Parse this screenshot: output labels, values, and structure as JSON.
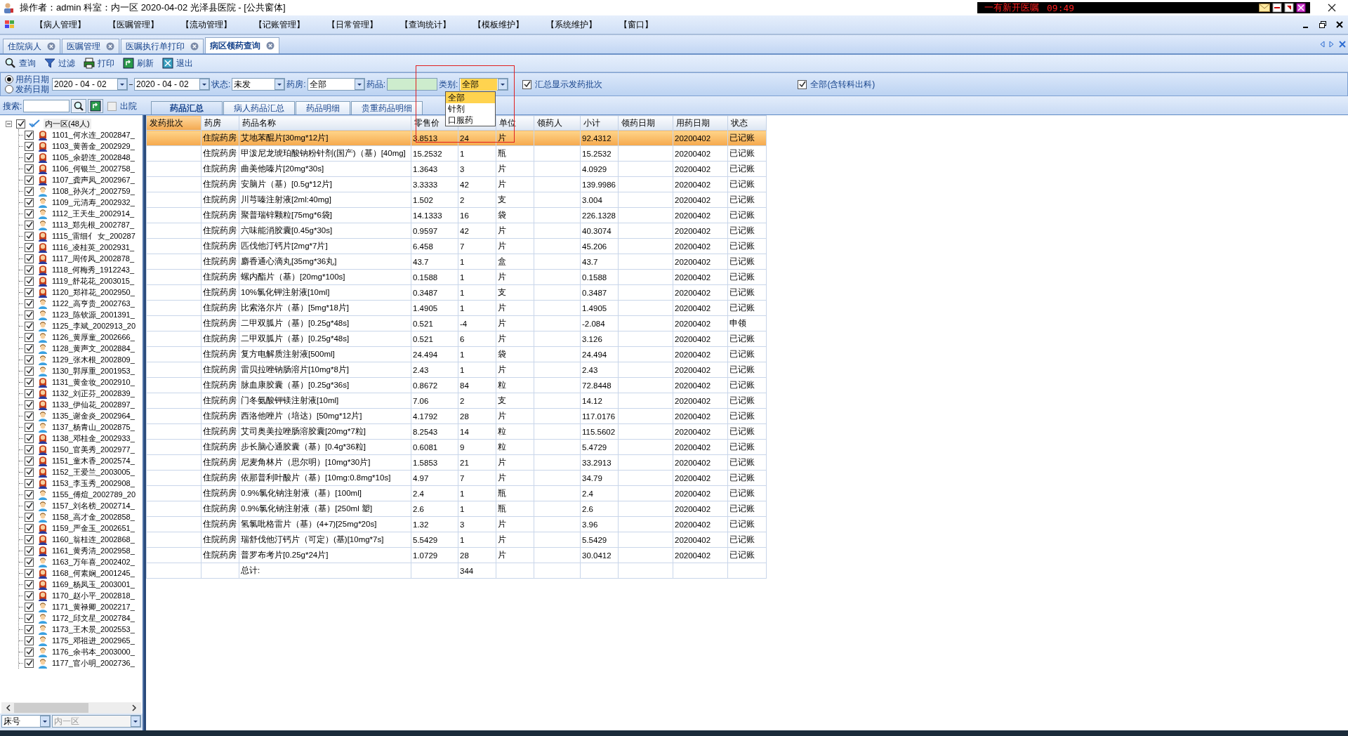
{
  "title_bar": {
    "text": "操作者：admin  科室：内一区  2020-04-02  光泽县医院 - [公共窗体]",
    "notice": {
      "text": "一有新开医嘱",
      "time": "09:49"
    }
  },
  "menu": [
    "【病人管理】",
    "【医嘱管理】",
    "【流动管理】",
    "【记账管理】",
    "【日常管理】",
    "【查询统计】",
    "【模板维护】",
    "【系统维护】",
    "【窗口】"
  ],
  "tabs": [
    {
      "label": "住院病人",
      "selected": false
    },
    {
      "label": "医嘱管理",
      "selected": false
    },
    {
      "label": "医嘱执行单打印",
      "selected": false
    },
    {
      "label": "病区领药查询",
      "selected": true
    }
  ],
  "toolbar": [
    {
      "label": "查询",
      "kind": "search"
    },
    {
      "label": "过滤",
      "kind": "filter"
    },
    {
      "label": "打印",
      "kind": "print"
    },
    {
      "label": "刷新",
      "kind": "refresh"
    },
    {
      "label": "退出",
      "kind": "exit"
    }
  ],
  "filters": {
    "date_modes": [
      {
        "label": "用药日期",
        "selected": true
      },
      {
        "label": "发药日期",
        "selected": false
      }
    ],
    "date_from": "2020 - 04 - 02",
    "date_to": "2020 - 04 - 02",
    "status": {
      "label": "状态:",
      "value": "未发"
    },
    "pharmacy": {
      "label": "药房:",
      "value": "全部"
    },
    "drug": {
      "label": "药品:"
    },
    "category": {
      "label": "类别:",
      "value": "全部",
      "options": [
        {
          "label": "全部",
          "selected": true
        },
        {
          "label": "针剂",
          "selected": false
        },
        {
          "label": "口服药",
          "selected": false
        }
      ]
    },
    "show_batch": {
      "label": "汇总显示发药批次",
      "checked": true
    },
    "all_depts": {
      "label": "全部(含转科出科)",
      "checked": true
    }
  },
  "search": {
    "label": "搜索:",
    "discharged": {
      "label": "出院",
      "checked": false
    }
  },
  "subtabs": [
    {
      "label": "药品汇总",
      "selected": true
    },
    {
      "label": "病人药品汇总",
      "selected": false
    },
    {
      "label": "药品明细",
      "selected": false
    },
    {
      "label": "贵重药品明细",
      "selected": false
    }
  ],
  "tree": {
    "label": "内一区(48人)",
    "checked": true,
    "expanded": true,
    "children": [
      {
        "label": "1101_何水连_2002847_",
        "kind": "female",
        "checked": true
      },
      {
        "label": "1103_黄善金_2002929_",
        "kind": "female",
        "checked": true
      },
      {
        "label": "1105_余碧连_2002848_",
        "kind": "female",
        "checked": true
      },
      {
        "label": "1106_何银兰_2002758_",
        "kind": "female",
        "checked": true
      },
      {
        "label": "1107_龚声凤_2002967_",
        "kind": "female",
        "checked": true
      },
      {
        "label": "1108_孙兴才_2002759_",
        "kind": "male",
        "checked": true
      },
      {
        "label": "1109_元清寿_2002932_",
        "kind": "male",
        "checked": true
      },
      {
        "label": "1112_王天生_2002914_",
        "kind": "male",
        "checked": true
      },
      {
        "label": "1113_郑先根_2002787_",
        "kind": "male",
        "checked": true
      },
      {
        "label": "1115_雷细亻 女_200287",
        "kind": "female",
        "checked": true
      },
      {
        "label": "1116_凌桂英_2002931_",
        "kind": "female",
        "checked": true
      },
      {
        "label": "1117_周传凤_2002878_",
        "kind": "female",
        "checked": true
      },
      {
        "label": "1118_何梅秀_1912243_",
        "kind": "female",
        "checked": true
      },
      {
        "label": "1119_舒花花_2003015_",
        "kind": "female",
        "checked": true
      },
      {
        "label": "1120_郑祥花_2002950_",
        "kind": "female",
        "checked": true
      },
      {
        "label": "1122_高亨贵_2002763_",
        "kind": "male",
        "checked": true
      },
      {
        "label": "1123_陈钦源_2001391_",
        "kind": "male",
        "checked": true
      },
      {
        "label": "1125_李斌_2002913_20",
        "kind": "male",
        "checked": true
      },
      {
        "label": "1126_黄厚童_2002666_",
        "kind": "male",
        "checked": true
      },
      {
        "label": "1128_黄声文_2002884_",
        "kind": "male",
        "checked": true
      },
      {
        "label": "1129_张木根_2002809_",
        "kind": "male",
        "checked": true
      },
      {
        "label": "1130_郭厚重_2001953_",
        "kind": "male",
        "checked": true
      },
      {
        "label": "1131_黄金妆_2002910_",
        "kind": "female",
        "checked": true
      },
      {
        "label": "1132_刘正芬_2002839_",
        "kind": "female",
        "checked": true
      },
      {
        "label": "1133_伊仙花_2002897_",
        "kind": "female",
        "checked": true
      },
      {
        "label": "1135_谢金炎_2002964_",
        "kind": "male",
        "checked": true
      },
      {
        "label": "1137_杨青山_2002875_",
        "kind": "male",
        "checked": true
      },
      {
        "label": "1138_邓桂金_2002933_",
        "kind": "female",
        "checked": true
      },
      {
        "label": "1150_官美秀_2002977_",
        "kind": "female",
        "checked": true
      },
      {
        "label": "1151_童木香_2002574_",
        "kind": "female",
        "checked": true
      },
      {
        "label": "1152_王爱兰_2003005_",
        "kind": "female",
        "checked": true
      },
      {
        "label": "1153_李玉秀_2002908_",
        "kind": "female",
        "checked": true
      },
      {
        "label": "1155_傅煊_2002789_20",
        "kind": "male",
        "checked": true
      },
      {
        "label": "1157_刘名榜_2002714_",
        "kind": "male",
        "checked": true
      },
      {
        "label": "1158_高才金_2002858_",
        "kind": "male",
        "checked": true
      },
      {
        "label": "1159_严金玉_2002651_",
        "kind": "female",
        "checked": true
      },
      {
        "label": "1160_翁桂连_2002868_",
        "kind": "female",
        "checked": true
      },
      {
        "label": "1161_黄秀清_2002958_",
        "kind": "female",
        "checked": true
      },
      {
        "label": "1163_万年喜_2002402_",
        "kind": "male",
        "checked": true
      },
      {
        "label": "1168_何素娴_2001245_",
        "kind": "female",
        "checked": true
      },
      {
        "label": "1169_杨凤玉_2003001_",
        "kind": "female",
        "checked": true
      },
      {
        "label": "1170_赵小平_2002818_",
        "kind": "female",
        "checked": true
      },
      {
        "label": "1171_黄禄卿_2002217_",
        "kind": "male",
        "checked": true
      },
      {
        "label": "1172_邱文星_2002784_",
        "kind": "male",
        "checked": true
      },
      {
        "label": "1173_王木景_2002553_",
        "kind": "male",
        "checked": true
      },
      {
        "label": "1175_邓祖进_2002965_",
        "kind": "male",
        "checked": true
      },
      {
        "label": "1176_余书本_2003000_",
        "kind": "male",
        "checked": true
      },
      {
        "label": "1177_官小明_2002736_",
        "kind": "male",
        "checked": true
      }
    ]
  },
  "tree_footer": {
    "sort": "床号",
    "ward": {
      "value": "内一区",
      "disabled": true
    }
  },
  "table": {
    "columns": [
      {
        "label": "发药批次"
      },
      {
        "label": "药房"
      },
      {
        "label": "药品名称"
      },
      {
        "label": "零售价"
      },
      {
        "covered": true
      },
      {
        "label": "单位"
      },
      {
        "label": "领药人"
      },
      {
        "label": "小计"
      },
      {
        "label": "领药日期"
      },
      {
        "label": "用药日期"
      },
      {
        "label": "状态"
      }
    ],
    "rows": [
      {
        "pharmacy": "住院药房",
        "name": "艾地苯醌片[30mg*12片]",
        "price": "3.8513",
        "qty": "24",
        "unit": "片",
        "subtotal": "92.4312",
        "date": "20200402",
        "status": "已记账",
        "selected": true
      },
      {
        "pharmacy": "住院药房",
        "name": "甲泼尼龙琥珀酸钠粉针剂(国产)（基）[40mg]",
        "price": "15.2532",
        "qty": "1",
        "unit": "瓶",
        "subtotal": "15.2532",
        "date": "20200402",
        "status": "已记账",
        "selected": false
      },
      {
        "pharmacy": "住院药房",
        "name": "曲美他嗪片[20mg*30s]",
        "price": "1.3643",
        "qty": "3",
        "unit": "片",
        "subtotal": "4.0929",
        "date": "20200402",
        "status": "已记账",
        "selected": false
      },
      {
        "pharmacy": "住院药房",
        "name": "安脑片（基）[0.5g*12片]",
        "price": "3.3333",
        "qty": "42",
        "unit": "片",
        "subtotal": "139.9986",
        "date": "20200402",
        "status": "已记账",
        "selected": false
      },
      {
        "pharmacy": "住院药房",
        "name": "川芎嗪注射液[2ml:40mg]",
        "price": "1.502",
        "qty": "2",
        "unit": "支",
        "subtotal": "3.004",
        "date": "20200402",
        "status": "已记账",
        "selected": false
      },
      {
        "pharmacy": "住院药房",
        "name": "聚普瑞锌颗粒[75mg*6袋]",
        "price": "14.1333",
        "qty": "16",
        "unit": "袋",
        "subtotal": "226.1328",
        "date": "20200402",
        "status": "已记账",
        "selected": false
      },
      {
        "pharmacy": "住院药房",
        "name": "六味能消胶囊[0.45g*30s]",
        "price": "0.9597",
        "qty": "42",
        "unit": "片",
        "subtotal": "40.3074",
        "date": "20200402",
        "status": "已记账",
        "selected": false
      },
      {
        "pharmacy": "住院药房",
        "name": "匹伐他汀钙片[2mg*7片]",
        "price": "6.458",
        "qty": "7",
        "unit": "片",
        "subtotal": "45.206",
        "date": "20200402",
        "status": "已记账",
        "selected": false
      },
      {
        "pharmacy": "住院药房",
        "name": "麝香通心滴丸[35mg*36丸]",
        "price": "43.7",
        "qty": "1",
        "unit": "盒",
        "subtotal": "43.7",
        "date": "20200402",
        "status": "已记账",
        "selected": false
      },
      {
        "pharmacy": "住院药房",
        "name": "螺内酯片（基）[20mg*100s]",
        "price": "0.1588",
        "qty": "1",
        "unit": "片",
        "subtotal": "0.1588",
        "date": "20200402",
        "status": "已记账",
        "selected": false
      },
      {
        "pharmacy": "住院药房",
        "name": "10%氯化钾注射液[10ml]",
        "price": "0.3487",
        "qty": "1",
        "unit": "支",
        "subtotal": "0.3487",
        "date": "20200402",
        "status": "已记账",
        "selected": false
      },
      {
        "pharmacy": "住院药房",
        "name": "比索洛尔片（基）[5mg*18片]",
        "price": "1.4905",
        "qty": "1",
        "unit": "片",
        "subtotal": "1.4905",
        "date": "20200402",
        "status": "已记账",
        "selected": false
      },
      {
        "pharmacy": "住院药房",
        "name": "二甲双胍片（基）[0.25g*48s]",
        "price": "0.521",
        "qty": "-4",
        "unit": "片",
        "subtotal": "-2.084",
        "date": "20200402",
        "status": "申领",
        "selected": false
      },
      {
        "pharmacy": "住院药房",
        "name": "二甲双胍片（基）[0.25g*48s]",
        "price": "0.521",
        "qty": "6",
        "unit": "片",
        "subtotal": "3.126",
        "date": "20200402",
        "status": "已记账",
        "selected": false
      },
      {
        "pharmacy": "住院药房",
        "name": "复方电解质注射液[500ml]",
        "price": "24.494",
        "qty": "1",
        "unit": "袋",
        "subtotal": "24.494",
        "date": "20200402",
        "status": "已记账",
        "selected": false
      },
      {
        "pharmacy": "住院药房",
        "name": "雷贝拉唑钠肠溶片[10mg*8片]",
        "price": "2.43",
        "qty": "1",
        "unit": "片",
        "subtotal": "2.43",
        "date": "20200402",
        "status": "已记账",
        "selected": false
      },
      {
        "pharmacy": "住院药房",
        "name": "脉血康胶囊（基）[0.25g*36s]",
        "price": "0.8672",
        "qty": "84",
        "unit": "粒",
        "subtotal": "72.8448",
        "date": "20200402",
        "status": "已记账",
        "selected": false
      },
      {
        "pharmacy": "住院药房",
        "name": "门冬氨酸钾镁注射液[10ml]",
        "price": "7.06",
        "qty": "2",
        "unit": "支",
        "subtotal": "14.12",
        "date": "20200402",
        "status": "已记账",
        "selected": false
      },
      {
        "pharmacy": "住院药房",
        "name": "西洛他唑片（培达）[50mg*12片]",
        "price": "4.1792",
        "qty": "28",
        "unit": "片",
        "subtotal": "117.0176",
        "date": "20200402",
        "status": "已记账",
        "selected": false
      },
      {
        "pharmacy": "住院药房",
        "name": "艾司奥美拉唑肠溶胶囊[20mg*7粒]",
        "price": "8.2543",
        "qty": "14",
        "unit": "粒",
        "subtotal": "115.5602",
        "date": "20200402",
        "status": "已记账",
        "selected": false
      },
      {
        "pharmacy": "住院药房",
        "name": "步长脑心通胶囊（基）[0.4g*36粒]",
        "price": "0.6081",
        "qty": "9",
        "unit": "粒",
        "subtotal": "5.4729",
        "date": "20200402",
        "status": "已记账",
        "selected": false
      },
      {
        "pharmacy": "住院药房",
        "name": "尼麦角林片（思尔明）[10mg*30片]",
        "price": "1.5853",
        "qty": "21",
        "unit": "片",
        "subtotal": "33.2913",
        "date": "20200402",
        "status": "已记账",
        "selected": false
      },
      {
        "pharmacy": "住院药房",
        "name": "依那普利叶酸片（基）[10mg:0.8mg*10s]",
        "price": "4.97",
        "qty": "7",
        "unit": "片",
        "subtotal": "34.79",
        "date": "20200402",
        "status": "已记账",
        "selected": false
      },
      {
        "pharmacy": "住院药房",
        "name": "0.9%氯化钠注射液（基）[100ml]",
        "price": "2.4",
        "qty": "1",
        "unit": "瓶",
        "subtotal": "2.4",
        "date": "20200402",
        "status": "已记账",
        "selected": false
      },
      {
        "pharmacy": "住院药房",
        "name": "0.9%氯化钠注射液（基）[250ml 塑]",
        "price": "2.6",
        "qty": "1",
        "unit": "瓶",
        "subtotal": "2.6",
        "date": "20200402",
        "status": "已记账",
        "selected": false
      },
      {
        "pharmacy": "住院药房",
        "name": "氢氯吡格雷片（基）(4+7)[25mg*20s]",
        "price": "1.32",
        "qty": "3",
        "unit": "片",
        "subtotal": "3.96",
        "date": "20200402",
        "status": "已记账",
        "selected": false
      },
      {
        "pharmacy": "住院药房",
        "name": "瑞舒伐他汀钙片（可定）(基)[10mg*7s]",
        "price": "5.5429",
        "qty": "1",
        "unit": "片",
        "subtotal": "5.5429",
        "date": "20200402",
        "status": "已记账",
        "selected": false
      },
      {
        "pharmacy": "住院药房",
        "name": "普罗布考片[0.25g*24片]",
        "price": "1.0729",
        "qty": "28",
        "unit": "片",
        "subtotal": "30.0412",
        "date": "20200402",
        "status": "已记账",
        "selected": false
      }
    ],
    "total": {
      "label": "总计:",
      "qty": "344"
    }
  }
}
